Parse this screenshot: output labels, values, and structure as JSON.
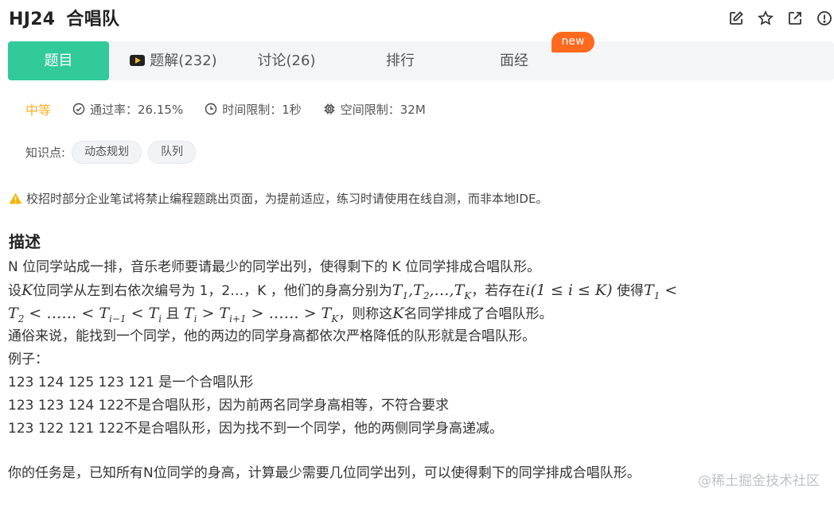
{
  "header": {
    "problem_id": "HJ24",
    "problem_title": "合唱队",
    "icons": [
      "edit-icon",
      "star-icon",
      "external-link-icon",
      "info-icon"
    ]
  },
  "tabs": [
    {
      "label": "题目",
      "active": true
    },
    {
      "label": "题解(232)",
      "icon": "video-icon"
    },
    {
      "label": "讨论(26)"
    },
    {
      "label": "排行"
    },
    {
      "label": "面经",
      "badge": "new"
    }
  ],
  "meta": {
    "difficulty": "中等",
    "pass_rate": "通过率：26.15%",
    "time_limit": "时间限制：1秒",
    "memory_limit": "空间限制：32M"
  },
  "knowledge": {
    "label": "知识点:",
    "tags": [
      "动态规划",
      "队列"
    ]
  },
  "warning": "校招时部分企业笔试将禁止编程题跳出页面，为提前适应，练习时请使用在线自测，而非本地IDE。",
  "description": {
    "heading": "描述",
    "line1": "N 位同学站成一排，音乐老师要请最少的同学出列，使得剩下的 K 位同学排成合唱队形。",
    "line2": {
      "a": "设",
      "b": "位同学从左到右依次编号为 1，2…，K ，他们的身高分别为",
      "c": "，若存在",
      "d": "使得"
    },
    "line3": {
      "a": "且",
      "b": "，则称这",
      "c": "名同学排成了合唱队形。"
    },
    "line4": "通俗来说，能找到一个同学，他的两边的同学身高都依次严格降低的队形就是合唱队形。",
    "line5": "例子：",
    "line6": "123 124 125 123 121 是一个合唱队形",
    "line7": "123 123 124 122不是合唱队形，因为前两名同学身高相等，不符合要求",
    "line8": "123 122 121 122不是合唱队形，因为找不到一个同学，他的两侧同学身高递减。",
    "line9": "你的任务是，已知所有N位同学的身高，计算最少需要几位同学出列，可以使得剩下的同学排成合唱队形。"
  },
  "watermark": "@稀土掘金技术社区",
  "colors": {
    "accent": "#32ca99",
    "difficulty": "#ffb020",
    "badge": "#ff6a1f"
  }
}
